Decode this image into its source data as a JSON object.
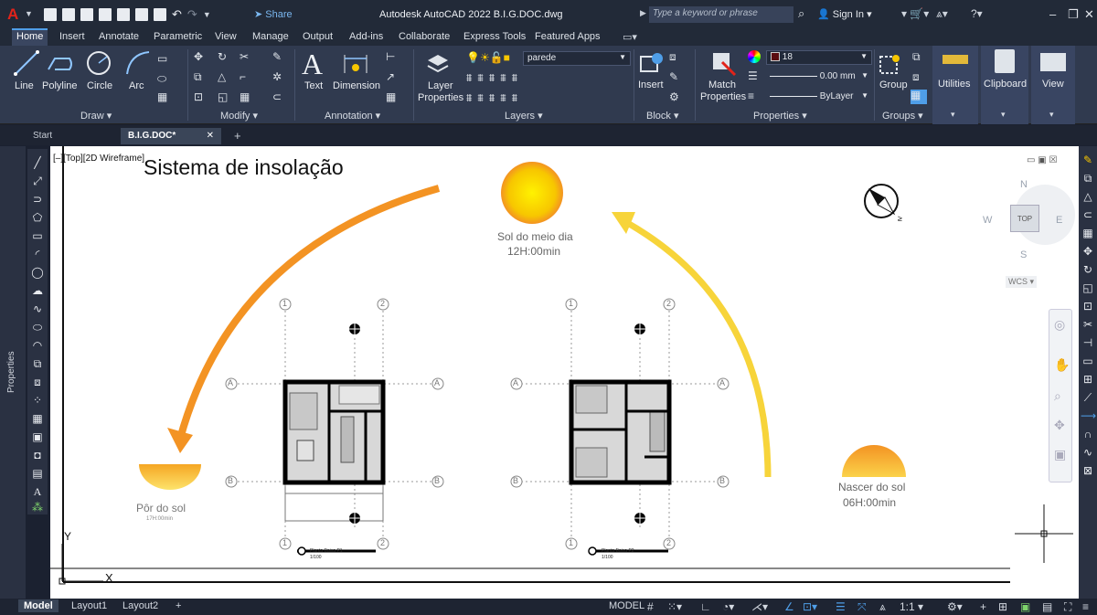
{
  "titlebar": {
    "logo": "A",
    "share_label": "Share",
    "app_title": "Autodesk AutoCAD 2022    B.I.G.DOC.dwg",
    "search_placeholder": "Type a keyword or phrase",
    "signin_label": "Sign In"
  },
  "menu_tabs": [
    "Home",
    "Insert",
    "Annotate",
    "Parametric",
    "View",
    "Manage",
    "Output",
    "Add-ins",
    "Collaborate",
    "Express Tools",
    "Featured Apps"
  ],
  "ribbon": {
    "draw": {
      "title": "Draw",
      "line": "Line",
      "polyline": "Polyline",
      "circle": "Circle",
      "arc": "Arc"
    },
    "modify": {
      "title": "Modify"
    },
    "annotation": {
      "title": "Annotation",
      "text": "Text",
      "dimension": "Dimension"
    },
    "layers": {
      "title": "Layers",
      "layer_properties_1": "Layer",
      "layer_properties_2": "Properties",
      "current_layer": "parede"
    },
    "block": {
      "title": "Block",
      "insert": "Insert"
    },
    "properties": {
      "title": "Properties",
      "match_1": "Match",
      "match_2": "Properties",
      "color_value": "18",
      "lineweight": "0.00 mm",
      "linetype": "ByLayer"
    },
    "groups": {
      "title": "Groups",
      "group": "Group"
    },
    "utilities": "Utilities",
    "clipboard": "Clipboard",
    "view": "View"
  },
  "doc_tabs": {
    "start": "Start",
    "active": "B.I.G.DOC*"
  },
  "left_palette": {
    "properties": "Properties"
  },
  "viewport": {
    "label": "[–][Top][2D Wireframe]"
  },
  "drawing": {
    "title": "Sistema de insolação",
    "sun_noon_1": "Sol do meio dia",
    "sun_noon_2": "12H:00min",
    "sunrise_1": "Nascer do sol",
    "sunrise_2": "06H:00min",
    "sunset_1": "Pôr do sol",
    "sunset_2": "17H:00min",
    "grid_a": "A",
    "grid_b": "B",
    "grid_1": "1",
    "grid_2": "2",
    "plan1_label": "Planta Baixa P1",
    "plan1_scale": "1/100",
    "plan2_label": "Planta Baixa P2",
    "plan2_scale": "1/100",
    "ucs_y": "Y",
    "ucs_x": "X"
  },
  "navcube": {
    "n": "N",
    "s": "S",
    "e": "E",
    "w": "W",
    "top": "TOP",
    "wcs": "WCS"
  },
  "status": {
    "model_tab": "Model",
    "layout1": "Layout1",
    "layout2": "Layout2",
    "model_label": "MODEL",
    "scale": "1:1"
  },
  "colors": {
    "sun_yellow": "#f7c600",
    "arc_orange": "#f39323",
    "arc_yellow": "#f7d43a",
    "accent_blue": "#4f9ee8"
  }
}
